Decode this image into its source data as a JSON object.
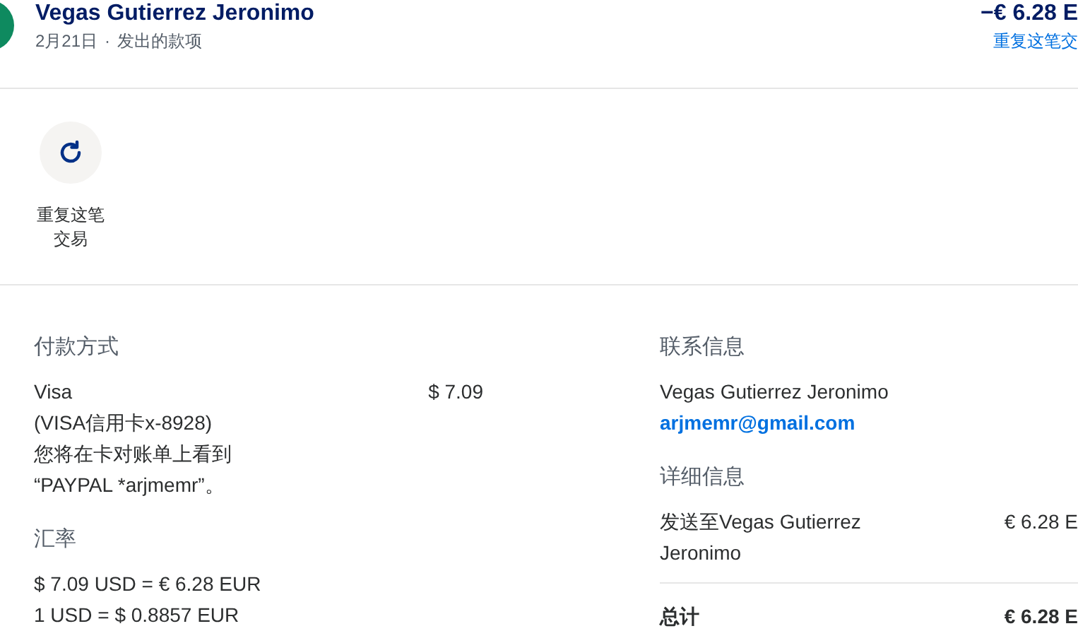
{
  "header": {
    "name": "Vegas Gutierrez Jeronimo",
    "date": "2月21日",
    "separator": "·",
    "type": "发出的款项",
    "amount": "−€ 6.28 E",
    "repeat_link": "重复这笔交"
  },
  "actions": [
    {
      "label": "重复这笔交易"
    }
  ],
  "payment": {
    "heading": "付款方式",
    "method": "Visa",
    "card": "(VISA信用卡x-8928)",
    "note": "您将在卡对账单上看到 “PAYPAL *arjmemr”。",
    "amount": "$ 7.09"
  },
  "exchange": {
    "heading": "汇率",
    "lines": [
      "$ 7.09 USD = € 6.28 EUR",
      "1 USD = $ 0.8857 EUR"
    ]
  },
  "contact": {
    "heading": "联系信息",
    "name": "Vegas Gutierrez Jeronimo",
    "email": "arjmemr@gmail.com"
  },
  "details": {
    "heading": "详细信息",
    "rows": [
      {
        "label": "发送至Vegas Gutierrez Jeronimo",
        "amount": "€ 6.28 E"
      }
    ],
    "total_label": "总计",
    "total_amount": "€ 6.28 E"
  }
}
